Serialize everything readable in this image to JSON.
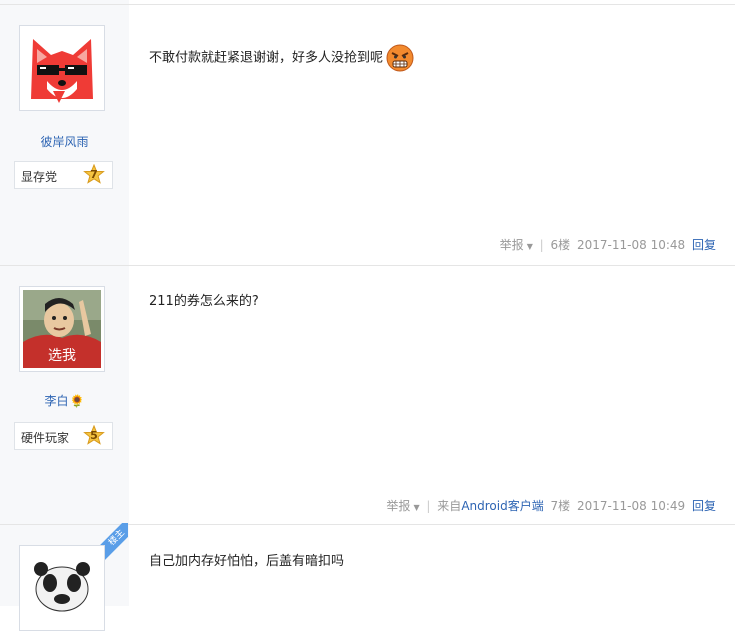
{
  "posts": [
    {
      "username": "彼岸风雨",
      "level_title": "显存党",
      "level": "7",
      "content": "不敢付款就赶紧退谢谢，好多人没抢到呢",
      "tail": {
        "report": "举报",
        "floor": "6楼",
        "time": "2017-11-08 10:48",
        "reply": "回复"
      }
    },
    {
      "username": "李白",
      "level_title": "硬件玩家",
      "level": "5",
      "content": "211的券怎么来的?",
      "tail": {
        "report": "举报",
        "client_prefix": "来自",
        "client": "Android客户端",
        "floor": "7楼",
        "time": "2017-11-08 10:49",
        "reply": "回复"
      }
    },
    {
      "badge": "楼主",
      "content": "自己加内存好怕怕，后盖有暗扣吗"
    }
  ],
  "avatars": {
    "post1": "red-fox-sunglasses-avatar",
    "post2": "meme-man-xuanwo-avatar",
    "post2_caption": "选我",
    "post3": "panda-meme-avatar"
  },
  "colors": {
    "link": "#2d64b3",
    "sidebar": "#f7f8fa",
    "badge": "#5a9ee8"
  }
}
